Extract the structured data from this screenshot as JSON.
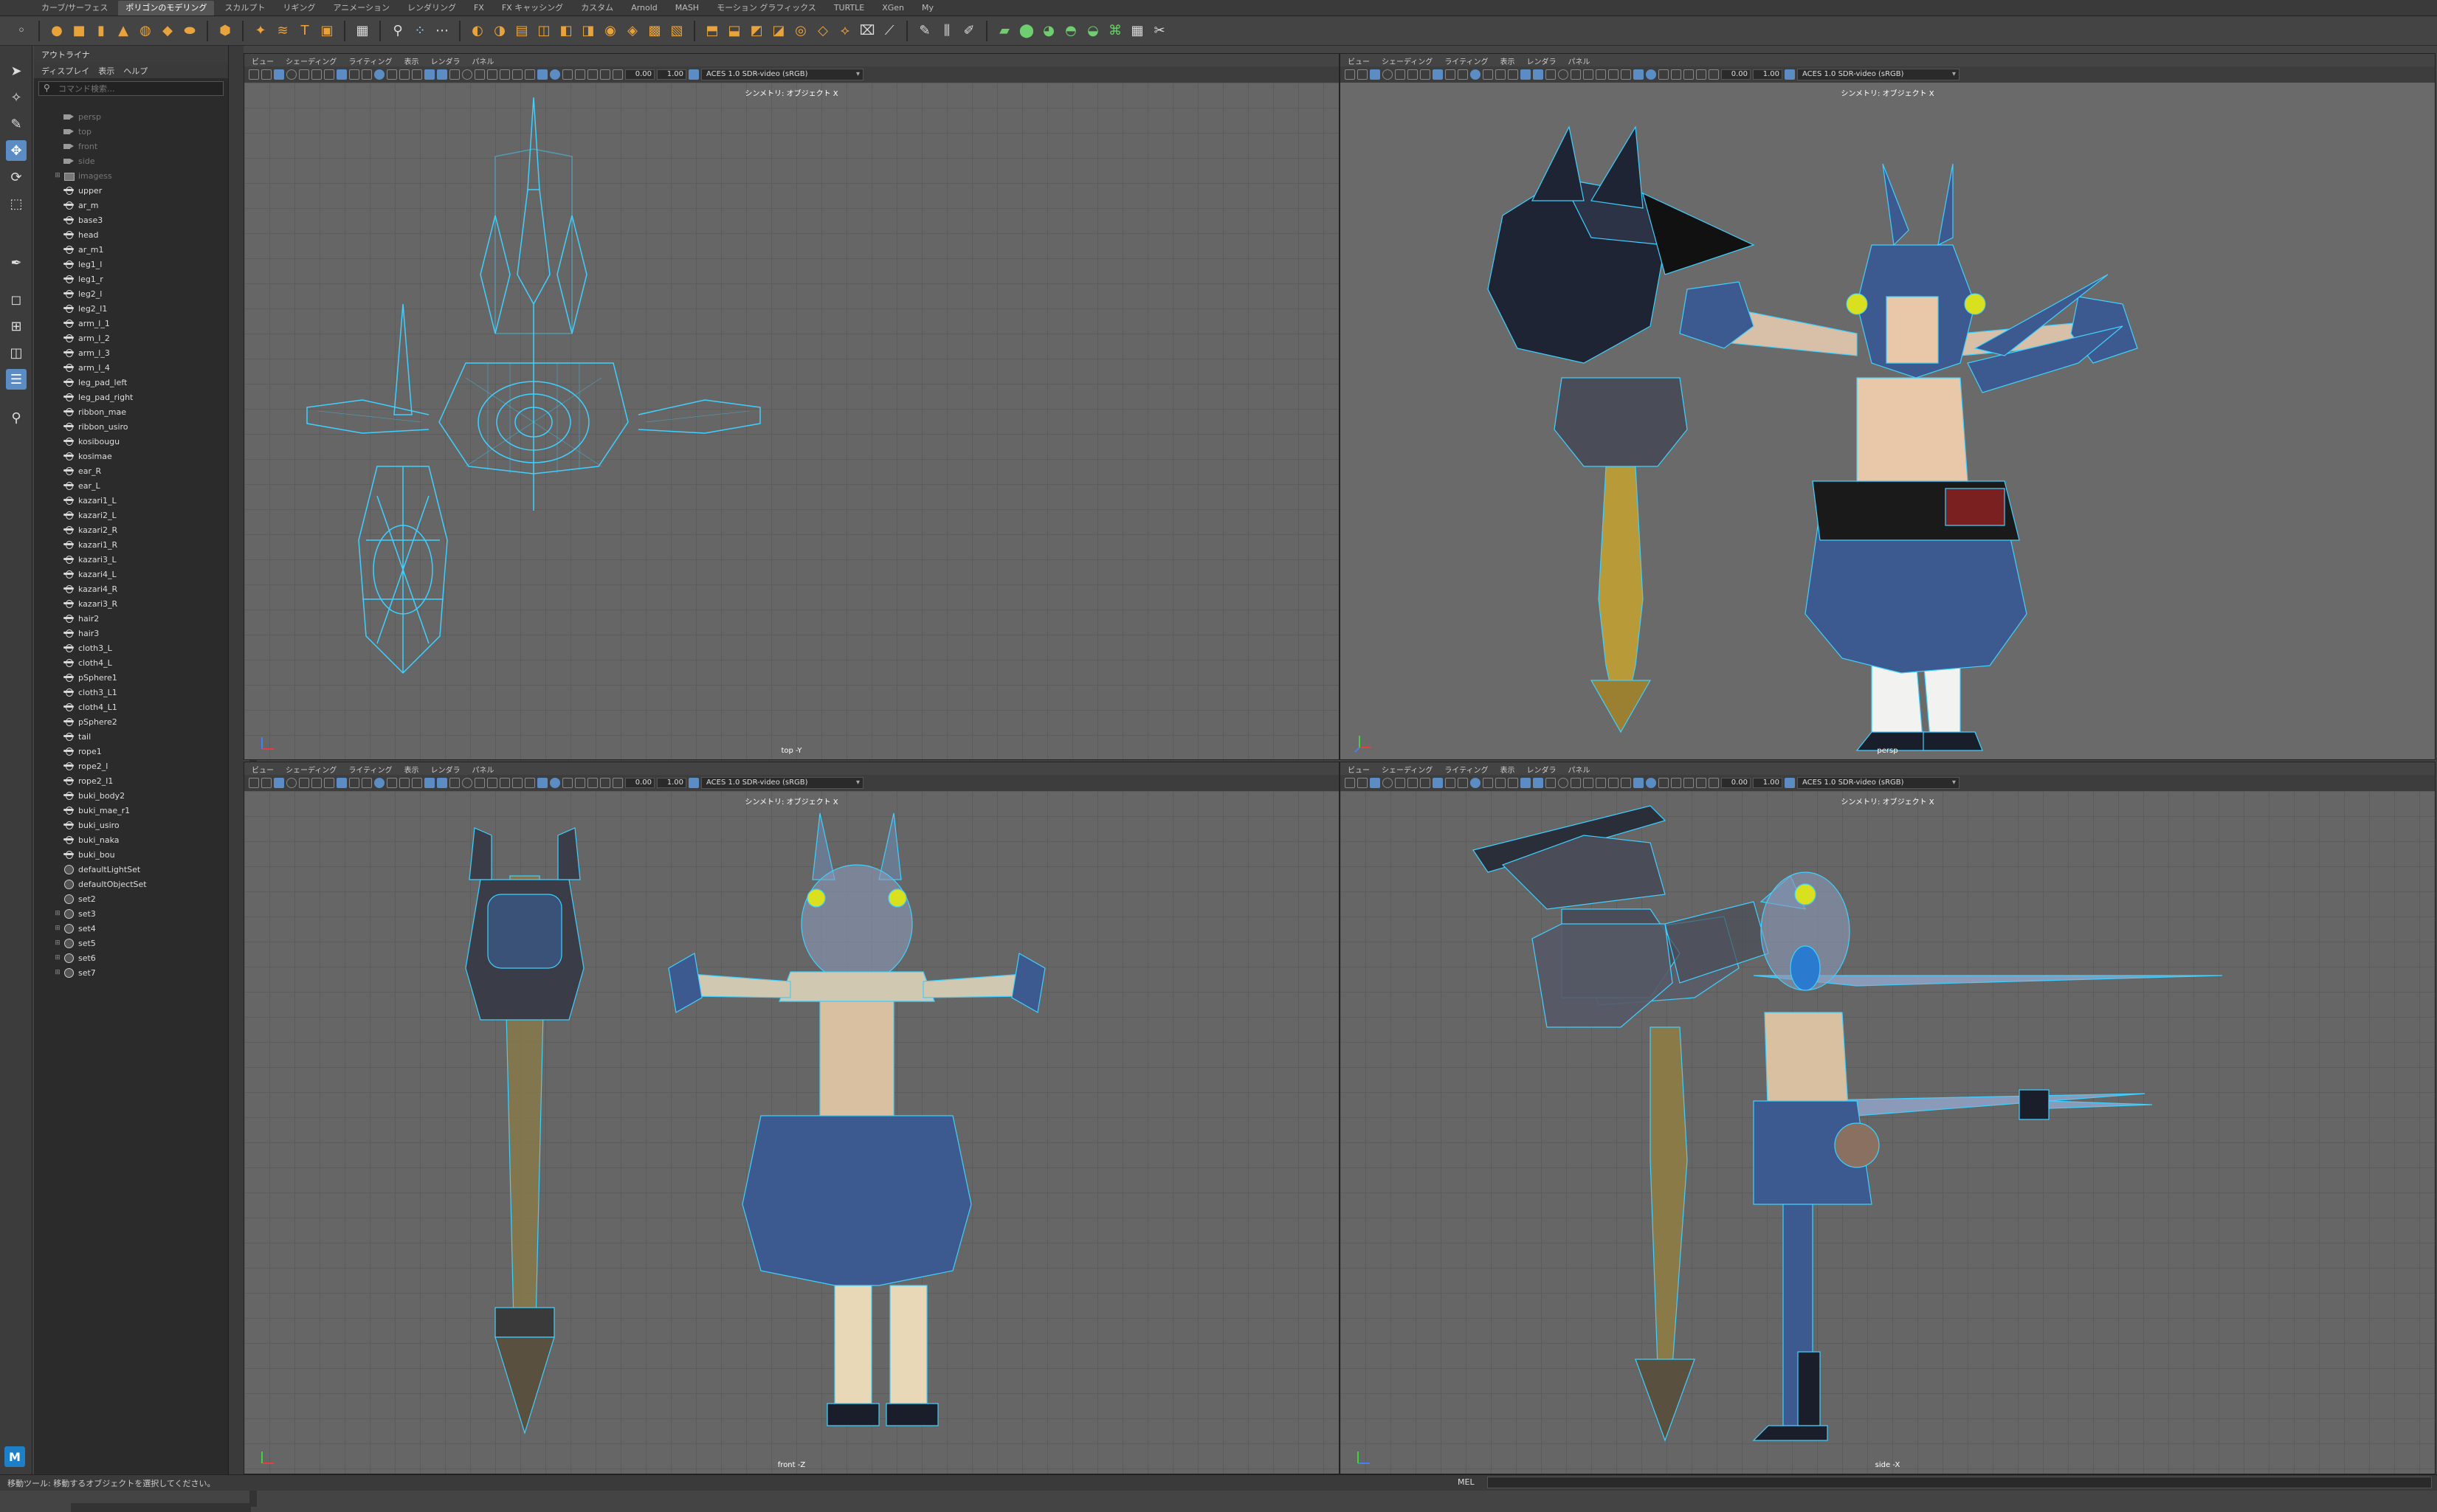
{
  "menu_tabs": [
    "カーブ/サーフェス",
    "ポリゴンのモデリング",
    "スカルプト",
    "リギング",
    "アニメーション",
    "レンダリング",
    "FX",
    "FX キャッシング",
    "カスタム",
    "Arnold",
    "MASH",
    "モーション グラフィックス",
    "TURTLE",
    "XGen",
    "My"
  ],
  "active_tab_index": 1,
  "outliner": {
    "title": "アウトライナ",
    "menu": [
      "ディスプレイ",
      "表示",
      "ヘルプ"
    ],
    "search_placeholder": "コマンド検索...",
    "items": [
      {
        "label": "persp",
        "type": "cam",
        "dim": true
      },
      {
        "label": "top",
        "type": "cam",
        "dim": true
      },
      {
        "label": "front",
        "type": "cam",
        "dim": true
      },
      {
        "label": "side",
        "type": "cam",
        "dim": true
      },
      {
        "label": "imagess",
        "type": "grp",
        "dim": true,
        "expand": true
      },
      {
        "label": "upper",
        "type": "mesh"
      },
      {
        "label": "ar_m",
        "type": "mesh"
      },
      {
        "label": "base3",
        "type": "mesh"
      },
      {
        "label": "head",
        "type": "mesh"
      },
      {
        "label": "ar_m1",
        "type": "mesh"
      },
      {
        "label": "leg1_l",
        "type": "mesh"
      },
      {
        "label": "leg1_r",
        "type": "mesh"
      },
      {
        "label": "leg2_l",
        "type": "mesh"
      },
      {
        "label": "leg2_l1",
        "type": "mesh"
      },
      {
        "label": "arm_l_1",
        "type": "mesh"
      },
      {
        "label": "arm_l_2",
        "type": "mesh"
      },
      {
        "label": "arm_l_3",
        "type": "mesh"
      },
      {
        "label": "arm_l_4",
        "type": "mesh"
      },
      {
        "label": "leg_pad_left",
        "type": "mesh"
      },
      {
        "label": "leg_pad_right",
        "type": "mesh"
      },
      {
        "label": "ribbon_mae",
        "type": "mesh"
      },
      {
        "label": "ribbon_usiro",
        "type": "mesh"
      },
      {
        "label": "kosibougu",
        "type": "mesh"
      },
      {
        "label": "kosimae",
        "type": "mesh"
      },
      {
        "label": "ear_R",
        "type": "mesh"
      },
      {
        "label": "ear_L",
        "type": "mesh"
      },
      {
        "label": "kazari1_L",
        "type": "mesh"
      },
      {
        "label": "kazari2_L",
        "type": "mesh"
      },
      {
        "label": "kazari2_R",
        "type": "mesh"
      },
      {
        "label": "kazari1_R",
        "type": "mesh"
      },
      {
        "label": "kazari3_L",
        "type": "mesh"
      },
      {
        "label": "kazari4_L",
        "type": "mesh"
      },
      {
        "label": "kazari4_R",
        "type": "mesh"
      },
      {
        "label": "kazari3_R",
        "type": "mesh"
      },
      {
        "label": "hair2",
        "type": "mesh"
      },
      {
        "label": "hair3",
        "type": "mesh"
      },
      {
        "label": "cloth3_L",
        "type": "mesh"
      },
      {
        "label": "cloth4_L",
        "type": "mesh"
      },
      {
        "label": "pSphere1",
        "type": "mesh"
      },
      {
        "label": "cloth3_L1",
        "type": "mesh"
      },
      {
        "label": "cloth4_L1",
        "type": "mesh"
      },
      {
        "label": "pSphere2",
        "type": "mesh"
      },
      {
        "label": "tail",
        "type": "mesh"
      },
      {
        "label": "rope1",
        "type": "mesh"
      },
      {
        "label": "rope2_l",
        "type": "mesh"
      },
      {
        "label": "rope2_l1",
        "type": "mesh"
      },
      {
        "label": "buki_body2",
        "type": "mesh"
      },
      {
        "label": "buki_mae_r1",
        "type": "mesh"
      },
      {
        "label": "buki_usiro",
        "type": "mesh"
      },
      {
        "label": "buki_naka",
        "type": "mesh"
      },
      {
        "label": "buki_bou",
        "type": "mesh"
      },
      {
        "label": "defaultLightSet",
        "type": "set"
      },
      {
        "label": "defaultObjectSet",
        "type": "set"
      },
      {
        "label": "set2",
        "type": "set"
      },
      {
        "label": "set3",
        "type": "set",
        "expand": true
      },
      {
        "label": "set4",
        "type": "set",
        "expand": true
      },
      {
        "label": "set5",
        "type": "set",
        "expand": true
      },
      {
        "label": "set6",
        "type": "set",
        "expand": true
      },
      {
        "label": "set7",
        "type": "set",
        "expand": true
      }
    ]
  },
  "viewport_menu": [
    "ビュー",
    "シェーディング",
    "ライティング",
    "表示",
    "レンダラ",
    "パネル"
  ],
  "viewports": {
    "top": {
      "stats": "シンメトリ: オブジェクト X",
      "camera": "top -Y",
      "exposure": "0.00",
      "gamma": "1.00",
      "colorspace": "ACES 1.0 SDR-video (sRGB)"
    },
    "persp": {
      "stats": "シンメトリ: オブジェクト X",
      "camera": "persp",
      "exposure": "0.00",
      "gamma": "1.00",
      "colorspace": "ACES 1.0 SDR-video (sRGB)"
    },
    "front": {
      "stats": "シンメトリ: オブジェクト X",
      "camera": "front -Z",
      "exposure": "0.00",
      "gamma": "1.00",
      "colorspace": "ACES 1.0 SDR-video (sRGB)"
    },
    "side": {
      "stats": "シンメトリ: オブジェクト X",
      "camera": "side -X",
      "exposure": "0.00",
      "gamma": "1.00",
      "colorspace": "ACES 1.0 SDR-video (sRGB)"
    }
  },
  "status_bar": {
    "message": "移動ツール: 移動するオブジェクトを選択してください。",
    "mel_label": "MEL"
  },
  "colors": {
    "accent": "#5c8cc4",
    "wireframe": "#3fd0ff",
    "shelf_icon": "#e8a33d",
    "shaft": "#c8a840",
    "body_blue": "#3c5a90"
  }
}
